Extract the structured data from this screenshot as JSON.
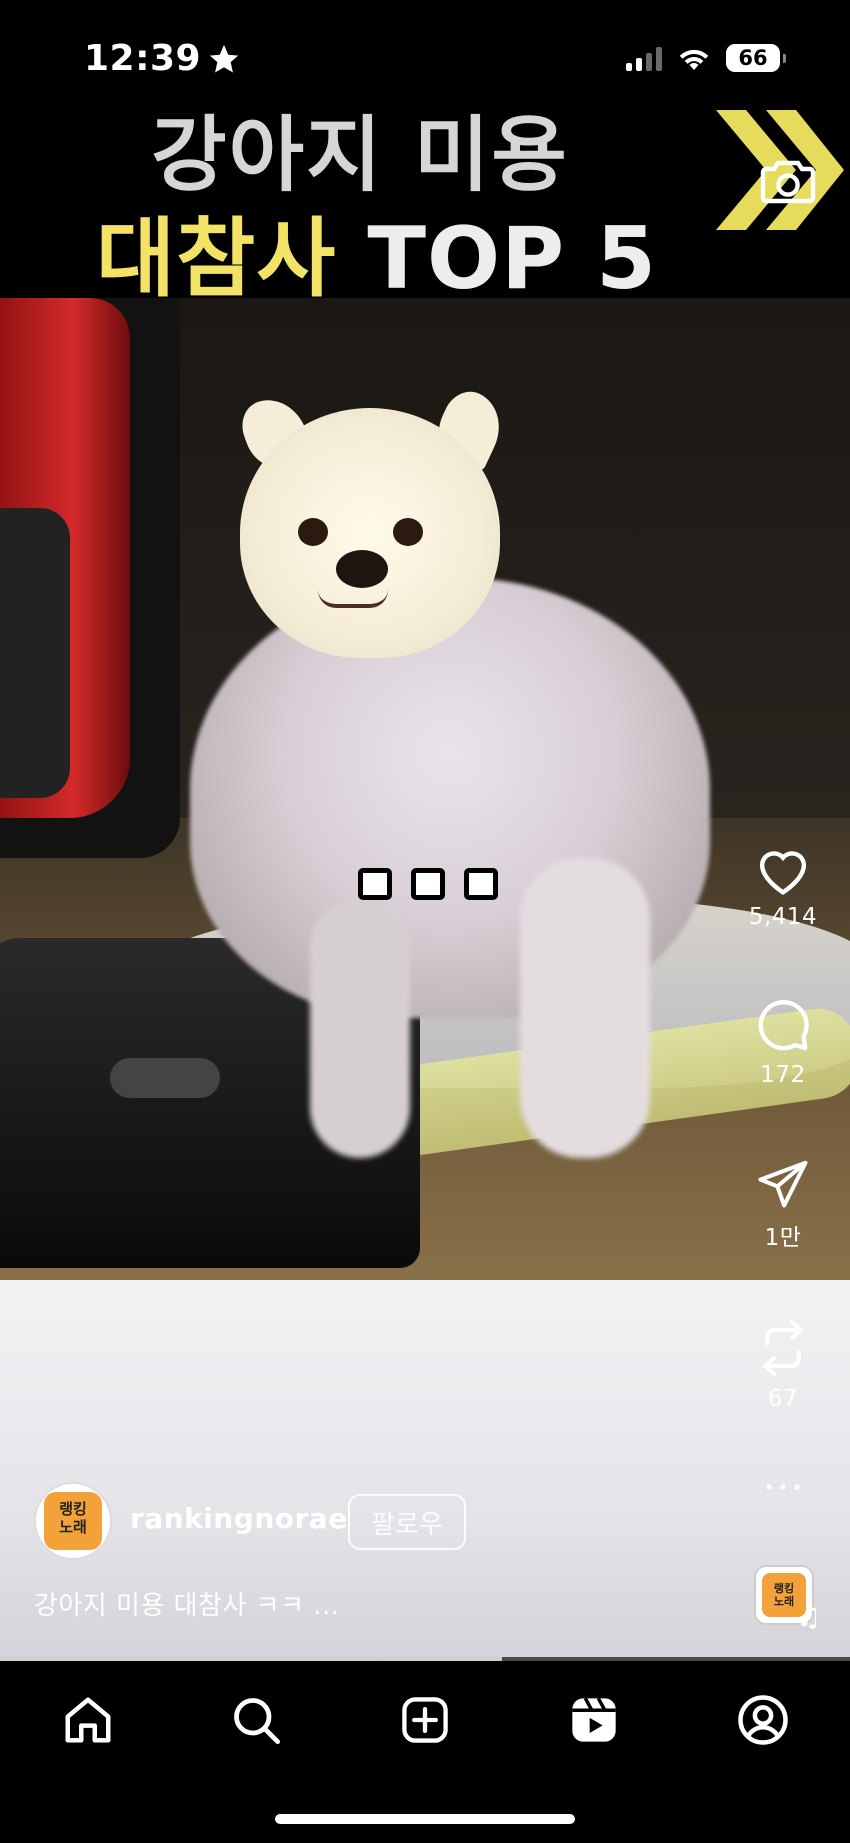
{
  "status_bar": {
    "time": "12:39",
    "battery": "66"
  },
  "banner": {
    "line1": "강아지 미용",
    "line2_highlight": "대참사",
    "line2_rest": "TOP 5"
  },
  "actions": {
    "likes": "5,414",
    "comments": "172",
    "shares": "1만",
    "remixes": "67"
  },
  "author": {
    "avatar_text_line1": "랭킹",
    "avatar_text_line2": "노래",
    "username": "rankingnorae",
    "follow_label": "팔로우"
  },
  "caption": "강아지 미용 대참사 ㅋㅋ ...",
  "playback_progress": 0.59,
  "colors": {
    "highlight_yellow": "#f2e366",
    "accent_orange": "#f3a23a"
  },
  "icons": [
    "star-icon",
    "signal-icon",
    "wifi-icon",
    "chevron-icon",
    "camera-icon",
    "heart-icon",
    "comment-icon",
    "send-icon",
    "repeat-icon",
    "more-icon",
    "music-note-icon",
    "home-icon",
    "search-icon",
    "add-icon",
    "reels-icon",
    "profile-icon"
  ]
}
